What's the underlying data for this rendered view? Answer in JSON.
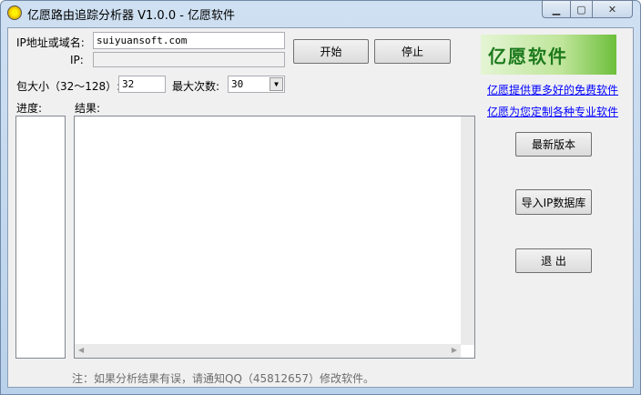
{
  "window": {
    "title": "亿愿路由追踪分析器 V1.0.0 - 亿愿软件",
    "minimize": "▁",
    "maximize": "▢",
    "close": "✕"
  },
  "form": {
    "host_label": "IP地址或域名:",
    "host_value": "suiyuansoft.com",
    "ip_label": "IP:",
    "ip_value": "",
    "size_label": "包大小（32～128）:",
    "size_value": "32",
    "max_label": "最大次数:",
    "max_value": "30"
  },
  "buttons": {
    "start": "开始",
    "stop": "停止",
    "latest": "最新版本",
    "import": "导入IP数据库",
    "exit": "退 出"
  },
  "panels": {
    "progress_label": "进度:",
    "result_label": "结果:"
  },
  "logo": {
    "text": "亿愿软件"
  },
  "links": [
    "亿愿提供更多好的免费软件",
    "亿愿为您定制各种专业软件"
  ],
  "note": "注：如果分析结果有误，请通知QQ（45812657）修改软件。"
}
